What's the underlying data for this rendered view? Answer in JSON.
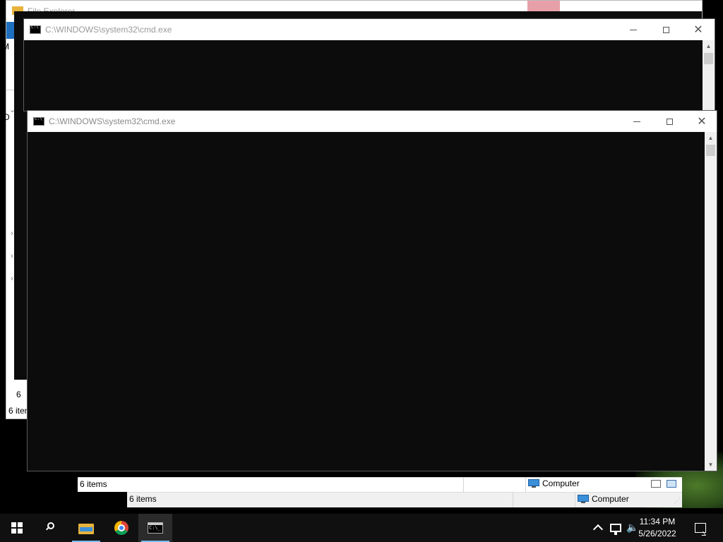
{
  "background_windows": {
    "explorer_back": {
      "title": "File Explorer",
      "status_items": "6 items",
      "left_nav_letters": [
        "M",
        "D",
        "6"
      ]
    },
    "explorer_mid": {
      "status_items": "6 items",
      "computer_label": "Computer"
    },
    "explorer_front": {
      "status_items": "6 items",
      "computer_label": "Computer"
    }
  },
  "cmd_windows": [
    {
      "title": "C:\\WINDOWS\\system32\\cmd.exe"
    },
    {
      "title": "C:\\WINDOWS\\system32\\cmd.exe"
    }
  ],
  "taskbar": {
    "apps": [
      "start",
      "search",
      "file-explorer",
      "chrome",
      "cmd"
    ],
    "clock": {
      "time": "11:34 PM",
      "date": "5/26/2022"
    }
  },
  "colors": {
    "console_bg": "#0c0c0c",
    "taskbar_bg": "#101010",
    "accent": "#76b9ed",
    "explorer_blue": "#1f6fbf",
    "close_hover_red": "#e8a0a8"
  }
}
